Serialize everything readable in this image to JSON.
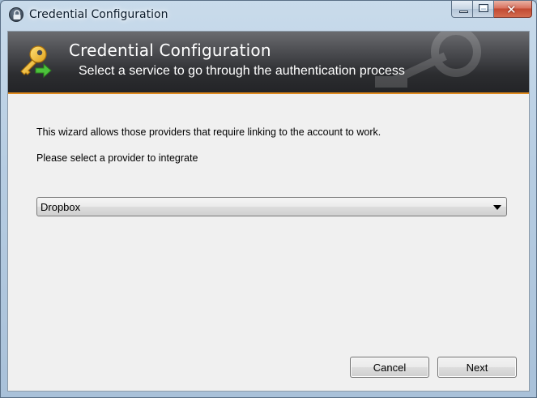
{
  "window": {
    "title": "Credential Configuration",
    "title_icon": "lock-icon",
    "controls": {
      "minimize_icon": "minimize-icon",
      "maximize_icon": "maximize-icon",
      "close_icon": "close-icon",
      "close_glyph": "✕"
    }
  },
  "banner": {
    "title": "Credential Configuration",
    "subtitle": "Select a service to go through the authentication process",
    "icon": "key-arrow-icon",
    "accent_color": "#e08a1e"
  },
  "content": {
    "intro": "This wizard allows those providers that require linking to the account to work.",
    "prompt": "Please select a provider to integrate",
    "provider_select": {
      "selected": "Dropbox",
      "icon": "chevron-down-icon"
    }
  },
  "buttons": {
    "cancel": "Cancel",
    "next": "Next"
  }
}
